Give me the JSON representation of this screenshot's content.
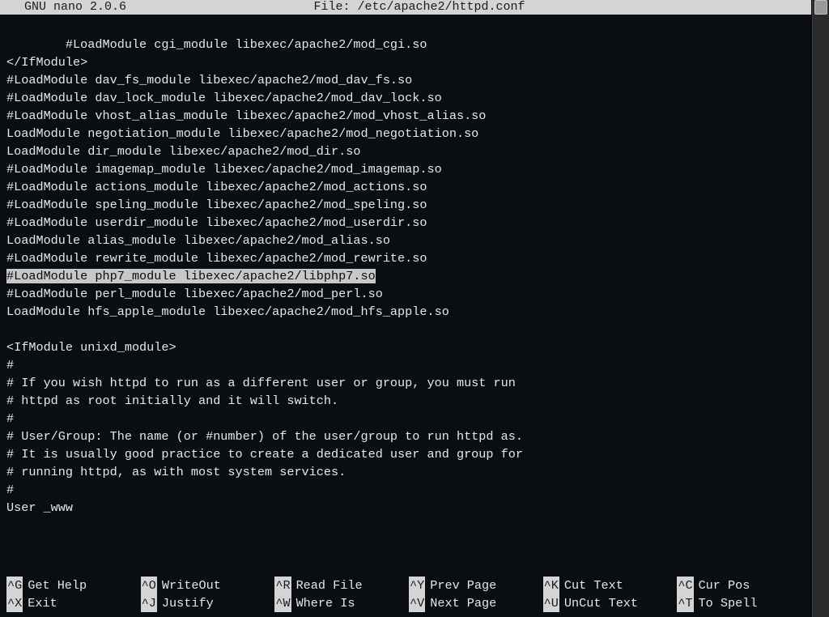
{
  "title_left": "  GNU nano 2.0.6",
  "title_center": "File: /etc/apache2/httpd.conf",
  "lines": [
    "",
    "        #LoadModule cgi_module libexec/apache2/mod_cgi.so",
    "</IfModule>",
    "#LoadModule dav_fs_module libexec/apache2/mod_dav_fs.so",
    "#LoadModule dav_lock_module libexec/apache2/mod_dav_lock.so",
    "#LoadModule vhost_alias_module libexec/apache2/mod_vhost_alias.so",
    "LoadModule negotiation_module libexec/apache2/mod_negotiation.so",
    "LoadModule dir_module libexec/apache2/mod_dir.so",
    "#LoadModule imagemap_module libexec/apache2/mod_imagemap.so",
    "#LoadModule actions_module libexec/apache2/mod_actions.so",
    "#LoadModule speling_module libexec/apache2/mod_speling.so",
    "#LoadModule userdir_module libexec/apache2/mod_userdir.so",
    "LoadModule alias_module libexec/apache2/mod_alias.so",
    "#LoadModule rewrite_module libexec/apache2/mod_rewrite.so",
    "#LoadModule php7_module libexec/apache2/libphp7.so",
    "#LoadModule perl_module libexec/apache2/mod_perl.so",
    "LoadModule hfs_apple_module libexec/apache2/mod_hfs_apple.so",
    "",
    "<IfModule unixd_module>",
    "#",
    "# If you wish httpd to run as a different user or group, you must run",
    "# httpd as root initially and it will switch.",
    "#",
    "# User/Group: The name (or #number) of the user/group to run httpd as.",
    "# It is usually good practice to create a dedicated user and group for",
    "# running httpd, as with most system services.",
    "#",
    "User _www"
  ],
  "highlight_index": 14,
  "shortcuts": [
    {
      "key": "^G",
      "label": "Get Help"
    },
    {
      "key": "^O",
      "label": "WriteOut"
    },
    {
      "key": "^R",
      "label": "Read File"
    },
    {
      "key": "^Y",
      "label": "Prev Page"
    },
    {
      "key": "^K",
      "label": "Cut Text"
    },
    {
      "key": "^C",
      "label": "Cur Pos"
    },
    {
      "key": "^X",
      "label": "Exit"
    },
    {
      "key": "^J",
      "label": "Justify"
    },
    {
      "key": "^W",
      "label": "Where Is"
    },
    {
      "key": "^V",
      "label": "Next Page"
    },
    {
      "key": "^U",
      "label": "UnCut Text"
    },
    {
      "key": "^T",
      "label": "To Spell"
    }
  ]
}
